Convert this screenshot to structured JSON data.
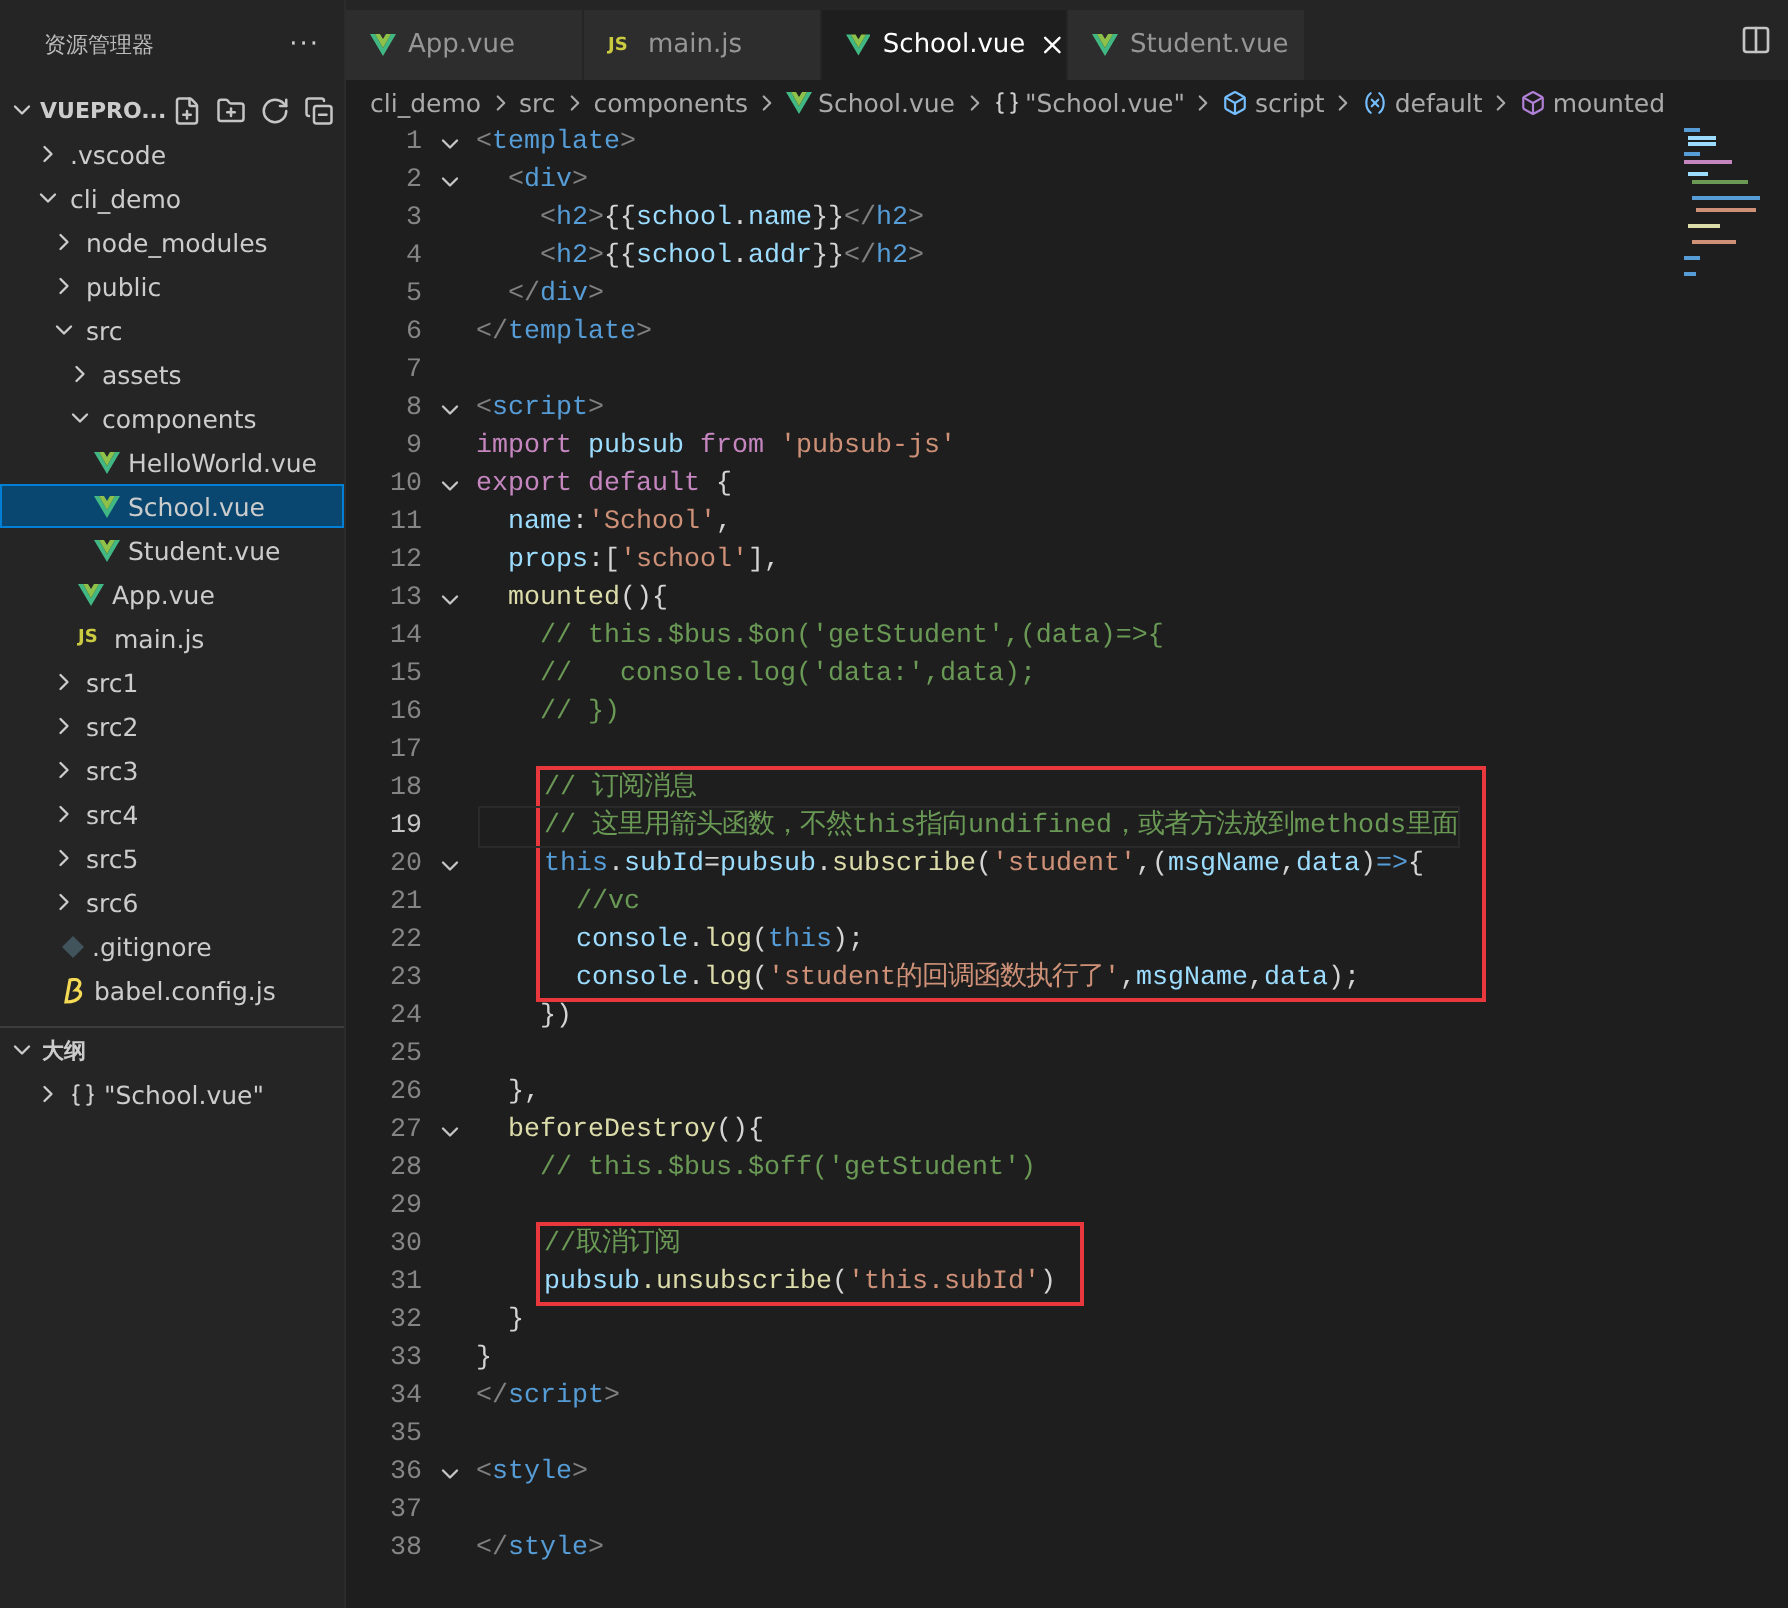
{
  "sidebar": {
    "title": "资源管理器",
    "more": "···",
    "section": {
      "title": "VUEPRO...",
      "expanded": true
    },
    "tree": [
      {
        "label": ".vscode",
        "kind": "folder",
        "expanded": false,
        "selected": false
      },
      {
        "label": "cli_demo",
        "kind": "folder",
        "expanded": true,
        "selected": false,
        "children": [
          {
            "label": "node_modules",
            "kind": "folder",
            "expanded": false,
            "selected": false
          },
          {
            "label": "public",
            "kind": "folder",
            "expanded": false,
            "selected": false
          },
          {
            "label": "src",
            "kind": "folder",
            "expanded": true,
            "selected": false,
            "children": [
              {
                "label": "assets",
                "kind": "folder",
                "expanded": false,
                "selected": false
              },
              {
                "label": "components",
                "kind": "folder",
                "expanded": true,
                "selected": false,
                "children": [
                  {
                    "label": "HelloWorld.vue",
                    "kind": "vue",
                    "selected": false
                  },
                  {
                    "label": "School.vue",
                    "kind": "vue",
                    "selected": true
                  },
                  {
                    "label": "Student.vue",
                    "kind": "vue",
                    "selected": false
                  }
                ]
              },
              {
                "label": "App.vue",
                "kind": "vue",
                "selected": false
              },
              {
                "label": "main.js",
                "kind": "js",
                "badge": "JS",
                "selected": false
              }
            ]
          },
          {
            "label": "src1",
            "kind": "folder",
            "expanded": false,
            "selected": false
          },
          {
            "label": "src2",
            "kind": "folder",
            "expanded": false,
            "selected": false
          },
          {
            "label": "src3",
            "kind": "folder",
            "expanded": false,
            "selected": false
          },
          {
            "label": "src4",
            "kind": "folder",
            "expanded": false,
            "selected": false
          },
          {
            "label": "src5",
            "kind": "folder",
            "expanded": false,
            "selected": false
          },
          {
            "label": "src6",
            "kind": "folder",
            "expanded": false,
            "selected": false
          },
          {
            "label": ".gitignore",
            "kind": "git",
            "selected": false
          },
          {
            "label": "babel.config.js",
            "kind": "babel",
            "selected": false
          }
        ]
      }
    ],
    "outline": {
      "title": "大纲",
      "expanded": true,
      "items": [
        {
          "label": "\"School.vue\"",
          "expanded": false
        }
      ]
    }
  },
  "tabs": [
    {
      "label": "App.vue",
      "kind": "vue",
      "selected": false
    },
    {
      "label": "main.js",
      "kind": "js",
      "badge": "JS",
      "selected": false
    },
    {
      "label": "School.vue",
      "kind": "vue",
      "selected": true
    },
    {
      "label": "Student.vue",
      "kind": "vue",
      "selected": false
    }
  ],
  "breadcrumb": [
    {
      "label": "cli_demo",
      "kind": "folder"
    },
    {
      "label": "src",
      "kind": "folder"
    },
    {
      "label": "components",
      "kind": "folder"
    },
    {
      "label": "School.vue",
      "kind": "vue"
    },
    {
      "label": "\"School.vue\"",
      "kind": "braces"
    },
    {
      "label": "script",
      "kind": "module"
    },
    {
      "label": "default",
      "kind": "variable"
    },
    {
      "label": "mounted",
      "kind": "method"
    }
  ],
  "code": {
    "sections": [
      {
        "boxed": false,
        "lines": [
          {
            "number": "1",
            "fold": true,
            "current": false,
            "tokens": [
              {
                "kind": "b",
                "text": "<"
              },
              {
                "kind": "tag",
                "text": "template"
              },
              {
                "kind": "b",
                "text": ">"
              }
            ]
          },
          {
            "number": "2",
            "fold": true,
            "current": false,
            "tokens": [
              {
                "kind": "b",
                "text": "  <"
              },
              {
                "kind": "tag",
                "text": "div"
              },
              {
                "kind": "b",
                "text": ">"
              }
            ]
          },
          {
            "number": "3",
            "fold": false,
            "current": false,
            "tokens": [
              {
                "kind": "b",
                "text": "    <"
              },
              {
                "kind": "tag",
                "text": "h2"
              },
              {
                "kind": "b",
                "text": ">"
              },
              {
                "kind": "t",
                "text": "{{"
              },
              {
                "kind": "var",
                "text": "school"
              },
              {
                "kind": "t",
                "text": "."
              },
              {
                "kind": "var",
                "text": "name"
              },
              {
                "kind": "t",
                "text": "}}"
              },
              {
                "kind": "b",
                "text": "</"
              },
              {
                "kind": "tag",
                "text": "h2"
              },
              {
                "kind": "b",
                "text": ">"
              }
            ]
          },
          {
            "number": "4",
            "fold": false,
            "current": false,
            "tokens": [
              {
                "kind": "b",
                "text": "    <"
              },
              {
                "kind": "tag",
                "text": "h2"
              },
              {
                "kind": "b",
                "text": ">"
              },
              {
                "kind": "t",
                "text": "{{"
              },
              {
                "kind": "var",
                "text": "school"
              },
              {
                "kind": "t",
                "text": "."
              },
              {
                "kind": "var",
                "text": "addr"
              },
              {
                "kind": "t",
                "text": "}}"
              },
              {
                "kind": "b",
                "text": "</"
              },
              {
                "kind": "tag",
                "text": "h2"
              },
              {
                "kind": "b",
                "text": ">"
              }
            ]
          },
          {
            "number": "5",
            "fold": false,
            "current": false,
            "tokens": [
              {
                "kind": "b",
                "text": "  </"
              },
              {
                "kind": "tag",
                "text": "div"
              },
              {
                "kind": "b",
                "text": ">"
              }
            ]
          },
          {
            "number": "6",
            "fold": false,
            "current": false,
            "tokens": [
              {
                "kind": "b",
                "text": "</"
              },
              {
                "kind": "tag",
                "text": "template"
              },
              {
                "kind": "b",
                "text": ">"
              }
            ]
          },
          {
            "number": "7",
            "fold": false,
            "current": false
          },
          {
            "number": "8",
            "fold": true,
            "current": false,
            "tokens": [
              {
                "kind": "b",
                "text": "<"
              },
              {
                "kind": "tag",
                "text": "script"
              },
              {
                "kind": "b",
                "text": ">"
              }
            ]
          },
          {
            "number": "9",
            "fold": false,
            "current": false,
            "tokens": [
              {
                "kind": "kw",
                "text": "import "
              },
              {
                "kind": "var",
                "text": "pubsub "
              },
              {
                "kind": "kw",
                "text": "from "
              },
              {
                "kind": "str",
                "text": "'pubsub-js'"
              }
            ]
          },
          {
            "number": "10",
            "fold": true,
            "current": false,
            "tokens": [
              {
                "kind": "kw",
                "text": "export default"
              },
              {
                "kind": "t",
                "text": " {"
              }
            ]
          },
          {
            "number": "11",
            "fold": false,
            "current": false,
            "tokens": [
              {
                "kind": "var",
                "text": "  name"
              },
              {
                "kind": "t",
                "text": ":"
              },
              {
                "kind": "str",
                "text": "'School'"
              },
              {
                "kind": "t",
                "text": ","
              }
            ]
          },
          {
            "number": "12",
            "fold": false,
            "current": false,
            "tokens": [
              {
                "kind": "var",
                "text": "  props"
              },
              {
                "kind": "t",
                "text": ":["
              },
              {
                "kind": "str",
                "text": "'school'"
              },
              {
                "kind": "t",
                "text": "],"
              }
            ]
          },
          {
            "number": "13",
            "fold": true,
            "current": false,
            "tokens": [
              {
                "kind": "fn",
                "text": "  mounted"
              },
              {
                "kind": "t",
                "text": "(){"
              }
            ]
          },
          {
            "number": "14",
            "fold": false,
            "current": false,
            "tokens": [
              {
                "kind": "com",
                "text": "    // this.$bus.$on('getStudent',(data)=>{"
              }
            ]
          },
          {
            "number": "15",
            "fold": false,
            "current": false,
            "tokens": [
              {
                "kind": "com",
                "text": "    //   console.log('data:',data);"
              }
            ]
          },
          {
            "number": "16",
            "fold": false,
            "current": false,
            "tokens": [
              {
                "kind": "com",
                "text": "    // })"
              }
            ]
          },
          {
            "number": "17",
            "fold": false,
            "current": false
          }
        ]
      },
      {
        "boxed": true,
        "lines": [
          {
            "number": "18",
            "fold": false,
            "current": false,
            "tokens": [
              {
                "kind": "com",
                "text": "    // 订阅消息"
              }
            ]
          },
          {
            "number": "19",
            "fold": false,
            "current": true,
            "tokens": [
              {
                "kind": "com",
                "text": "    // 这里用箭头函数，不然this指向undifined，或者方法放到methods里面"
              }
            ]
          },
          {
            "number": "20",
            "fold": true,
            "current": false,
            "tokens": [
              {
                "kind": "this",
                "text": "    this"
              },
              {
                "kind": "t",
                "text": "."
              },
              {
                "kind": "var",
                "text": "subId"
              },
              {
                "kind": "t",
                "text": "="
              },
              {
                "kind": "var",
                "text": "pubsub"
              },
              {
                "kind": "t",
                "text": "."
              },
              {
                "kind": "fn",
                "text": "subscribe"
              },
              {
                "kind": "t",
                "text": "("
              },
              {
                "kind": "str",
                "text": "'student'"
              },
              {
                "kind": "t",
                "text": ",("
              },
              {
                "kind": "var",
                "text": "msgName"
              },
              {
                "kind": "t",
                "text": ","
              },
              {
                "kind": "var",
                "text": "data"
              },
              {
                "kind": "t",
                "text": ")"
              },
              {
                "kind": "this",
                "text": "=>"
              },
              {
                "kind": "t",
                "text": "{"
              }
            ]
          },
          {
            "number": "21",
            "fold": false,
            "current": false,
            "tokens": [
              {
                "kind": "com",
                "text": "      //vc"
              }
            ]
          },
          {
            "number": "22",
            "fold": false,
            "current": false,
            "tokens": [
              {
                "kind": "var",
                "text": "      console"
              },
              {
                "kind": "t",
                "text": "."
              },
              {
                "kind": "fn",
                "text": "log"
              },
              {
                "kind": "t",
                "text": "("
              },
              {
                "kind": "this",
                "text": "this"
              },
              {
                "kind": "t",
                "text": ");"
              }
            ]
          },
          {
            "number": "23",
            "fold": false,
            "current": false,
            "tokens": [
              {
                "kind": "var",
                "text": "      console"
              },
              {
                "kind": "t",
                "text": "."
              },
              {
                "kind": "fn",
                "text": "log"
              },
              {
                "kind": "t",
                "text": "("
              },
              {
                "kind": "str",
                "text": "'student的回调函数执行了'"
              },
              {
                "kind": "t",
                "text": ","
              },
              {
                "kind": "var",
                "text": "msgName"
              },
              {
                "kind": "t",
                "text": ","
              },
              {
                "kind": "var",
                "text": "data"
              },
              {
                "kind": "t",
                "text": ");"
              }
            ]
          }
        ]
      },
      {
        "boxed": false,
        "lines": [
          {
            "number": "24",
            "fold": false,
            "current": false,
            "tokens": [
              {
                "kind": "t",
                "text": "    })"
              }
            ]
          },
          {
            "number": "25",
            "fold": false,
            "current": false
          },
          {
            "number": "26",
            "fold": false,
            "current": false,
            "tokens": [
              {
                "kind": "t",
                "text": "  },"
              }
            ]
          },
          {
            "number": "27",
            "fold": true,
            "current": false,
            "tokens": [
              {
                "kind": "fn",
                "text": "  beforeDestroy"
              },
              {
                "kind": "t",
                "text": "(){"
              }
            ]
          },
          {
            "number": "28",
            "fold": false,
            "current": false,
            "tokens": [
              {
                "kind": "com",
                "text": "    // this.$bus.$off('getStudent')"
              }
            ]
          },
          {
            "number": "29",
            "fold": false,
            "current": false
          }
        ]
      },
      {
        "boxed": true,
        "lines": [
          {
            "number": "30",
            "fold": false,
            "current": false,
            "tokens": [
              {
                "kind": "com",
                "text": "    //取消订阅"
              }
            ]
          },
          {
            "number": "31",
            "fold": false,
            "current": false,
            "tokens": [
              {
                "kind": "var",
                "text": "    pubsub"
              },
              {
                "kind": "fn",
                "text": ".unsubscribe"
              },
              {
                "kind": "t",
                "text": "("
              },
              {
                "kind": "str",
                "text": "'this.subId'"
              },
              {
                "kind": "t",
                "text": ")"
              }
            ]
          }
        ]
      },
      {
        "boxed": false,
        "lines": [
          {
            "number": "32",
            "fold": false,
            "current": false,
            "tokens": [
              {
                "kind": "t",
                "text": "  }"
              }
            ]
          },
          {
            "number": "33",
            "fold": false,
            "current": false,
            "tokens": [
              {
                "kind": "t",
                "text": "}"
              }
            ]
          },
          {
            "number": "34",
            "fold": false,
            "current": false,
            "tokens": [
              {
                "kind": "b",
                "text": "</"
              },
              {
                "kind": "tag",
                "text": "script"
              },
              {
                "kind": "b",
                "text": ">"
              }
            ]
          },
          {
            "number": "35",
            "fold": false,
            "current": false
          },
          {
            "number": "36",
            "fold": true,
            "current": false,
            "tokens": [
              {
                "kind": "b",
                "text": "<"
              },
              {
                "kind": "tag",
                "text": "style"
              },
              {
                "kind": "b",
                "text": ">"
              }
            ]
          },
          {
            "number": "37",
            "fold": false,
            "current": false
          },
          {
            "number": "38",
            "fold": false,
            "current": false,
            "tokens": [
              {
                "kind": "b",
                "text": "</"
              },
              {
                "kind": "tag",
                "text": "style"
              },
              {
                "kind": "b",
                "text": ">"
              }
            ]
          }
        ]
      }
    ]
  }
}
